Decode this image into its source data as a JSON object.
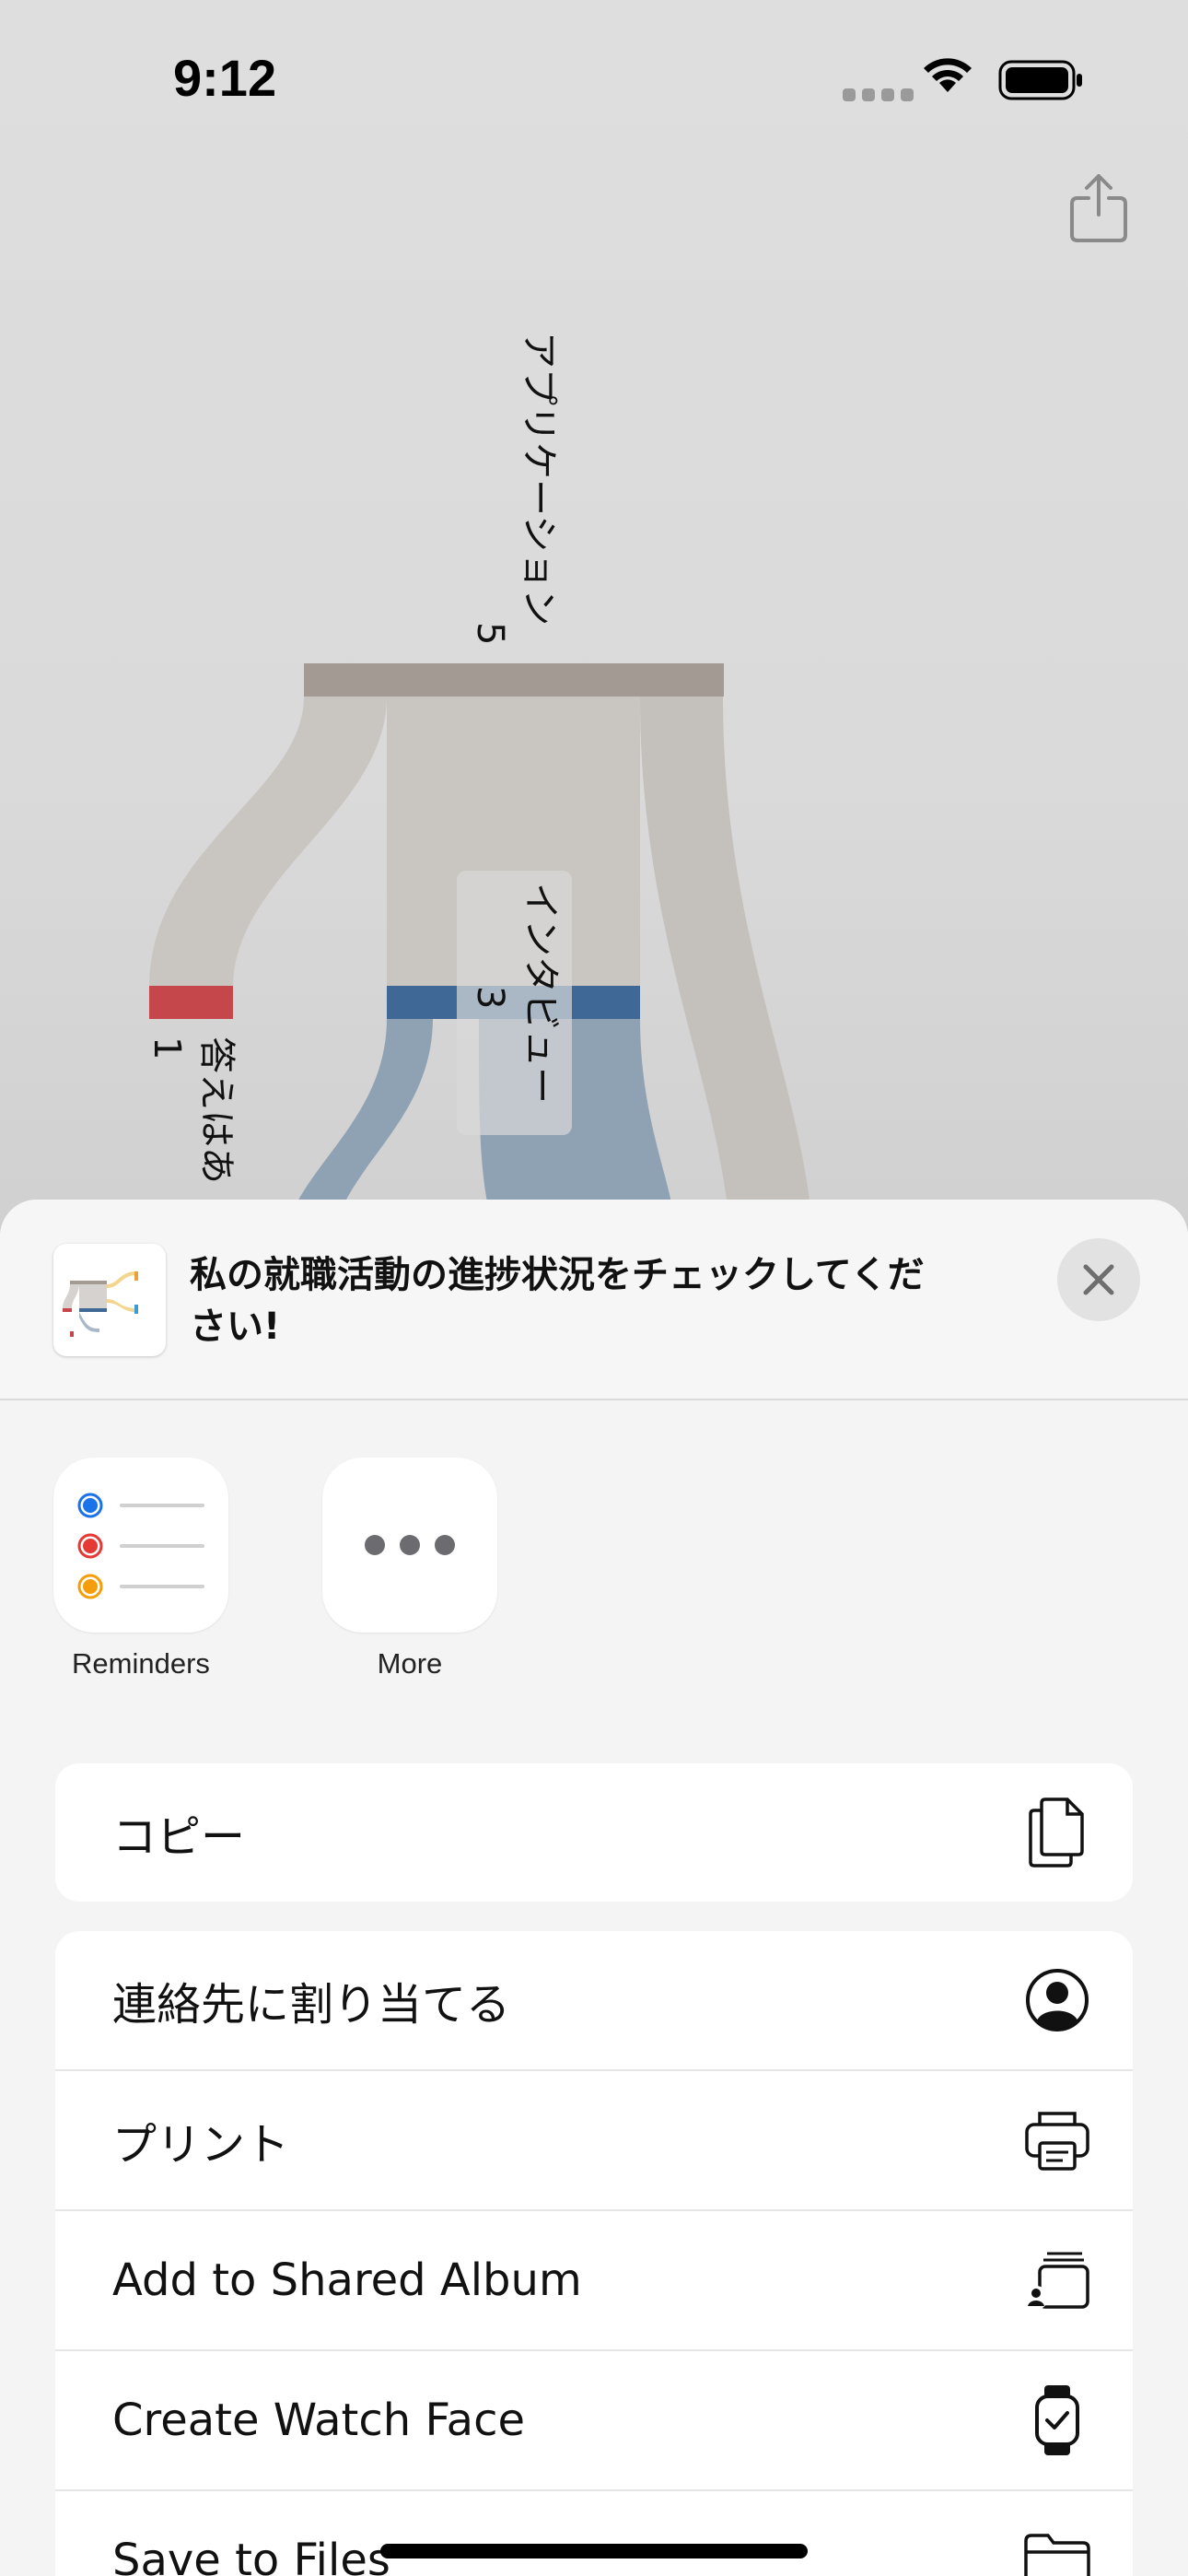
{
  "status_bar": {
    "time": "9:12"
  },
  "chart": {
    "nodes": [
      {
        "label": "アプリケーション",
        "count": "5",
        "color": "#a39a94"
      },
      {
        "label": "インタビュー",
        "count": "3",
        "color": "#3f6896"
      },
      {
        "label": "答えはあ",
        "count": "1",
        "color": "#c5474c"
      }
    ]
  },
  "share_sheet": {
    "title": "私の就職活動の進捗状況をチェックしてください!",
    "apps": [
      {
        "label": "Reminders",
        "icon": "reminders-icon"
      },
      {
        "label": "More",
        "icon": "more-icon"
      }
    ],
    "actions_top": [
      {
        "label": "コピー",
        "icon": "copy-icon"
      }
    ],
    "actions": [
      {
        "label": "連絡先に割り当てる",
        "icon": "person-circle-icon"
      },
      {
        "label": "プリント",
        "icon": "printer-icon"
      },
      {
        "label": "Add to Shared Album",
        "icon": "shared-album-icon"
      },
      {
        "label": "Create Watch Face",
        "icon": "watch-icon"
      },
      {
        "label": "Save to Files",
        "icon": "folder-icon"
      }
    ]
  }
}
